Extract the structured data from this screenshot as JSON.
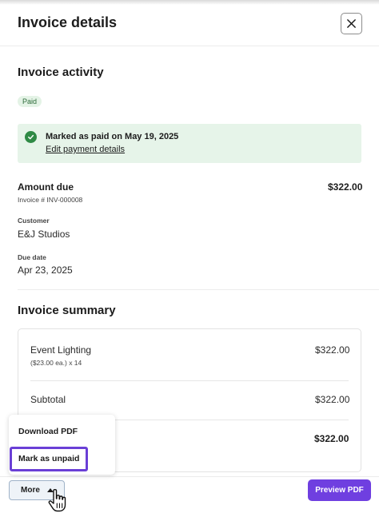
{
  "header": {
    "title": "Invoice details",
    "close_icon": "close-icon"
  },
  "activity": {
    "title": "Invoice activity",
    "status_badge": "Paid",
    "alert": {
      "icon": "check-circle-icon",
      "title": "Marked as paid on May 19, 2025",
      "link": "Edit payment details",
      "color": "#2f8a45"
    }
  },
  "amount": {
    "label": "Amount due",
    "value": "$322.00",
    "invoice_number": "Invoice # INV-000008"
  },
  "customer": {
    "label": "Customer",
    "value": "E&J Studios"
  },
  "due_date": {
    "label": "Due date",
    "value": "Apr 23, 2025"
  },
  "summary": {
    "title": "Invoice summary",
    "item": {
      "name": "Event Lighting",
      "detail": "($23.00 ea.) x 14",
      "price": "$322.00"
    },
    "subtotal": {
      "label": "Subtotal",
      "value": "$322.00"
    },
    "total": {
      "value": "$322.00"
    }
  },
  "menu": {
    "items": [
      "Download PDF",
      "Mark as unpaid"
    ],
    "highlight_color": "#6a3fd6"
  },
  "footer": {
    "more_label": "More",
    "more_icon": "caret-up-icon",
    "preview_label": "Preview PDF",
    "accent": "#6f3fe0",
    "cursor_icon": "hand-pointer-icon"
  }
}
